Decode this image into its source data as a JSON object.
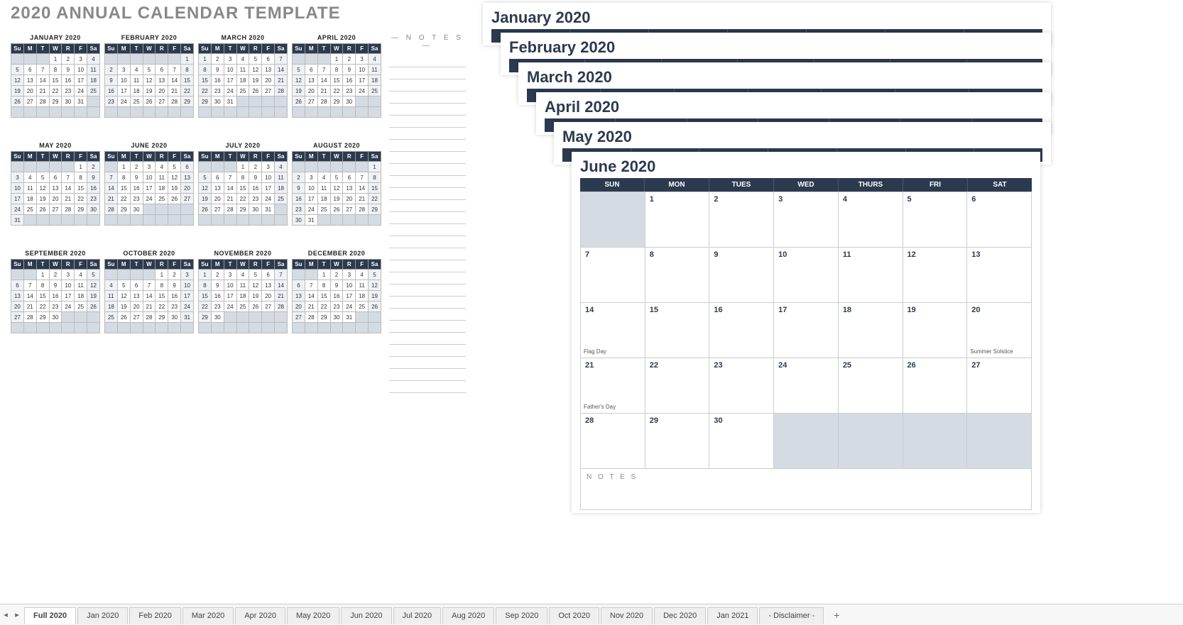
{
  "title": "2020 ANNUAL CALENDAR TEMPLATE",
  "notes_label": "— N O T E S —",
  "mini_dow": [
    "Su",
    "M",
    "T",
    "W",
    "R",
    "F",
    "Sa"
  ],
  "stack_dow": [
    "SUN",
    "MON",
    "TUES",
    "WED",
    "THURS",
    "FRI",
    "SAT"
  ],
  "months": [
    {
      "name": "JANUARY 2020",
      "start": 3,
      "days": 31
    },
    {
      "name": "FEBRUARY 2020",
      "start": 6,
      "days": 29
    },
    {
      "name": "MARCH 2020",
      "start": 0,
      "days": 31
    },
    {
      "name": "APRIL 2020",
      "start": 3,
      "days": 30
    },
    {
      "name": "MAY 2020",
      "start": 5,
      "days": 31
    },
    {
      "name": "JUNE 2020",
      "start": 1,
      "days": 30
    },
    {
      "name": "JULY 2020",
      "start": 3,
      "days": 31
    },
    {
      "name": "AUGUST 2020",
      "start": 6,
      "days": 31
    },
    {
      "name": "SEPTEMBER 2020",
      "start": 2,
      "days": 30
    },
    {
      "name": "OCTOBER 2020",
      "start": 4,
      "days": 31
    },
    {
      "name": "NOVEMBER 2020",
      "start": 0,
      "days": 30
    },
    {
      "name": "DECEMBER 2020",
      "start": 2,
      "days": 31
    }
  ],
  "stack_months": [
    {
      "title": "January 2020"
    },
    {
      "title": "February 2020"
    },
    {
      "title": "March 2020"
    },
    {
      "title": "April 2020"
    },
    {
      "title": "May 2020"
    }
  ],
  "big_month": {
    "title": "June 2020",
    "notes_label": "N O T E S",
    "grid": [
      [
        {
          "n": "",
          "out": true
        },
        {
          "n": "1"
        },
        {
          "n": "2"
        },
        {
          "n": "3"
        },
        {
          "n": "4"
        },
        {
          "n": "5"
        },
        {
          "n": "6"
        }
      ],
      [
        {
          "n": "7"
        },
        {
          "n": "8"
        },
        {
          "n": "9"
        },
        {
          "n": "10"
        },
        {
          "n": "11"
        },
        {
          "n": "12"
        },
        {
          "n": "13"
        }
      ],
      [
        {
          "n": "14",
          "ev": "Flag Day"
        },
        {
          "n": "15"
        },
        {
          "n": "16"
        },
        {
          "n": "17"
        },
        {
          "n": "18"
        },
        {
          "n": "19"
        },
        {
          "n": "20",
          "ev": "Summer Solstice"
        }
      ],
      [
        {
          "n": "21",
          "ev": "Father's Day"
        },
        {
          "n": "22"
        },
        {
          "n": "23"
        },
        {
          "n": "24"
        },
        {
          "n": "25"
        },
        {
          "n": "26"
        },
        {
          "n": "27"
        }
      ],
      [
        {
          "n": "28"
        },
        {
          "n": "29"
        },
        {
          "n": "30"
        },
        {
          "n": "",
          "out": true
        },
        {
          "n": "",
          "out": true
        },
        {
          "n": "",
          "out": true
        },
        {
          "n": "",
          "out": true
        }
      ]
    ]
  },
  "tabs": [
    "Full 2020",
    "Jan 2020",
    "Feb 2020",
    "Mar 2020",
    "Apr 2020",
    "May 2020",
    "Jun 2020",
    "Jul 2020",
    "Aug 2020",
    "Sep 2020",
    "Oct 2020",
    "Nov 2020",
    "Dec 2020",
    "Jan 2021",
    "- Disclaimer -"
  ],
  "active_tab": 0
}
